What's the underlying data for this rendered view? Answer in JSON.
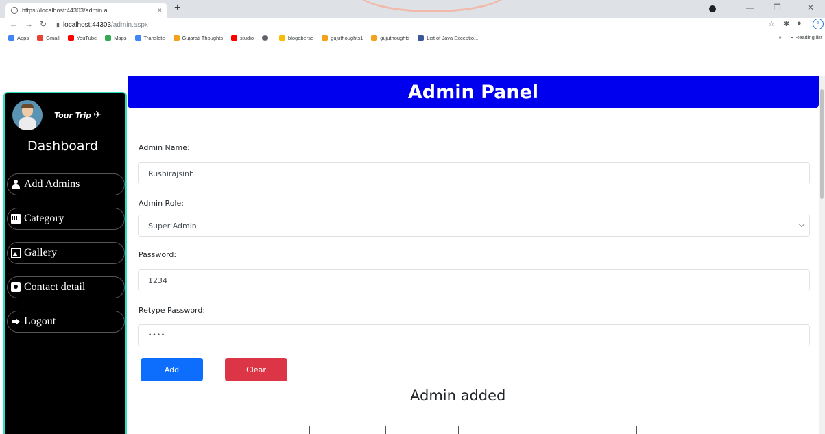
{
  "browser": {
    "tab_title": "https://localhost:44303/admin.a",
    "tab_close": "×",
    "new_tab": "+",
    "url_host": "localhost:44303",
    "url_path": "/admin.aspx",
    "bookmarks": [
      {
        "label": "Apps",
        "color": "#4285f4"
      },
      {
        "label": "Gmail",
        "color": "#ea4335"
      },
      {
        "label": "YouTube",
        "color": "#ff0000"
      },
      {
        "label": "Maps",
        "color": "#34a853"
      },
      {
        "label": "Translate",
        "color": "#4285f4"
      },
      {
        "label": "Gujarati Thoughts",
        "color": "#f4a11d"
      },
      {
        "label": "studio",
        "color": "#ff0000"
      },
      {
        "label": "",
        "color": "#5f6368"
      },
      {
        "label": "blogaberse",
        "color": "#fbbc04"
      },
      {
        "label": "gujuthoughts1",
        "color": "#f4a11d"
      },
      {
        "label": "gujuthoughts",
        "color": "#f4a11d"
      },
      {
        "label": "List of Java Exceptio...",
        "color": "#3b5998"
      }
    ],
    "more_bookmarks": "»",
    "reading_list": "Reading list"
  },
  "sidebar": {
    "brand": "Tour Trip",
    "dashboard": "Dashboard",
    "items": [
      {
        "label": "Add Admins",
        "icon": "user-icon"
      },
      {
        "label": "Category",
        "icon": "keyboard-icon"
      },
      {
        "label": "Gallery",
        "icon": "image-icon"
      },
      {
        "label": "Contact detail",
        "icon": "contact-icon"
      },
      {
        "label": "Logout",
        "icon": "logout-icon"
      }
    ]
  },
  "header": {
    "title": "Admin Panel"
  },
  "form": {
    "admin_name_label": "Admin Name:",
    "admin_name_value": "Rushirajsinh",
    "admin_role_label": "Admin Role:",
    "admin_role_value": "Super Admin",
    "password_label": "Password:",
    "password_value": "1234",
    "retype_label": "Retype Password:",
    "retype_value": "••••",
    "add_button": "Add",
    "clear_button": "Clear"
  },
  "section": {
    "title": "Admin added"
  },
  "colors": {
    "header": "#0000ee",
    "sidebar": "#000000",
    "sidebar_border": "#2ee0c2",
    "add": "#0d6efd",
    "clear": "#dc3545"
  }
}
